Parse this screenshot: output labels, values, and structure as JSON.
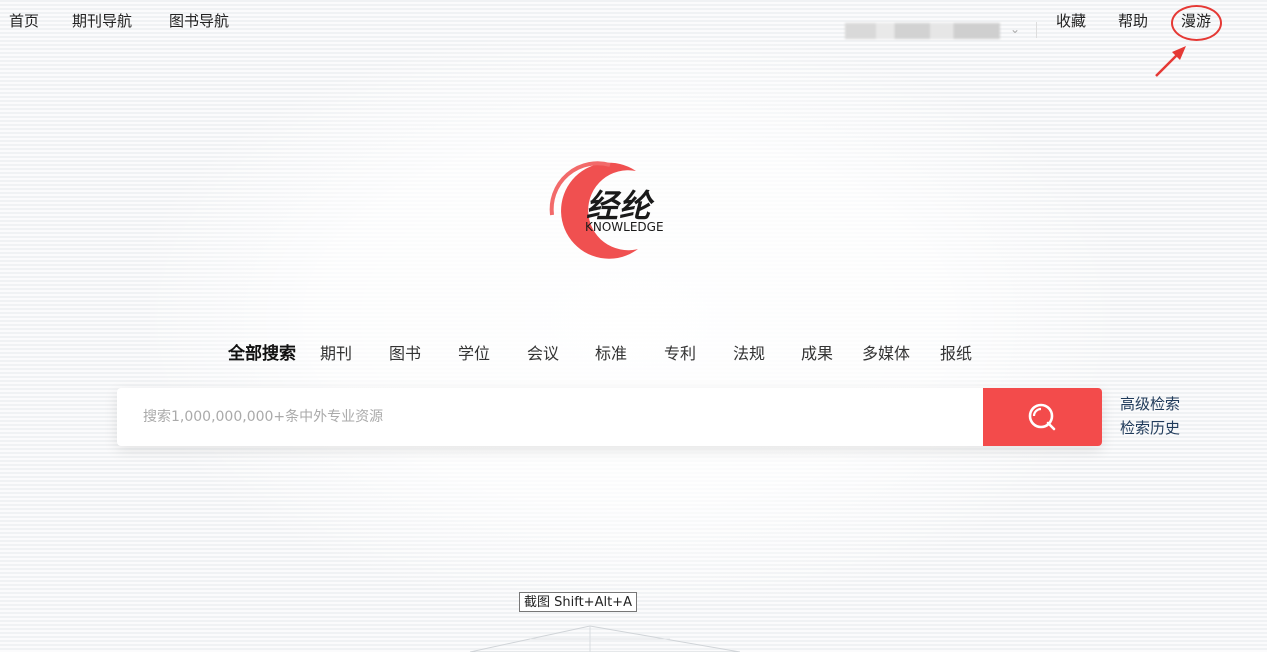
{
  "nav": {
    "left": [
      "首页",
      "期刊导航",
      "图书导航"
    ],
    "collect": "收藏",
    "help": "帮助",
    "roam": "漫游"
  },
  "logo": {
    "cn": "经纶",
    "en": "KNOWLEDGE"
  },
  "search": {
    "tabs": [
      "全部搜索",
      "期刊",
      "图书",
      "学位",
      "会议",
      "标准",
      "专利",
      "法规",
      "成果",
      "多媒体",
      "报纸"
    ],
    "active_tab": "全部搜索",
    "placeholder": "搜索1,000,000,000+条中外专业资源",
    "value": "",
    "advanced": "高级检索",
    "history": "检索历史",
    "button_icon": "search-icon"
  },
  "tooltip": "截图 Shift+Alt+A",
  "colors": {
    "accent": "#f34b4b",
    "annotation": "#e53935"
  }
}
